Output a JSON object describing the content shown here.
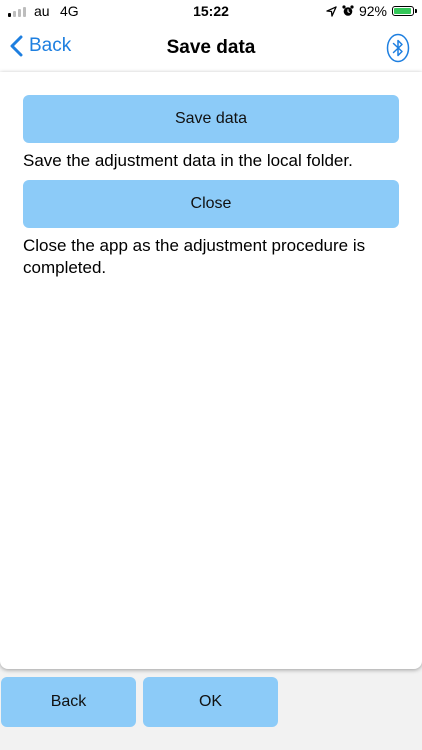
{
  "status_bar": {
    "carrier": "au",
    "network": "4G",
    "time": "15:22",
    "battery": "92%",
    "battery_level": 0.92
  },
  "nav": {
    "back_label": "Back",
    "title": "Save data",
    "bluetooth_icon": "bluetooth-icon"
  },
  "content": {
    "save_button": "Save data",
    "save_description": "Save the adjustment data in the local folder.",
    "close_button": "Close",
    "close_description": "Close the app as the adjustment procedure is completed."
  },
  "footer": {
    "back_button": "Back",
    "ok_button": "OK"
  },
  "colors": {
    "accent": "#1e7fe0",
    "button_fill": "#8ccbf8",
    "battery_green": "#34c759"
  }
}
